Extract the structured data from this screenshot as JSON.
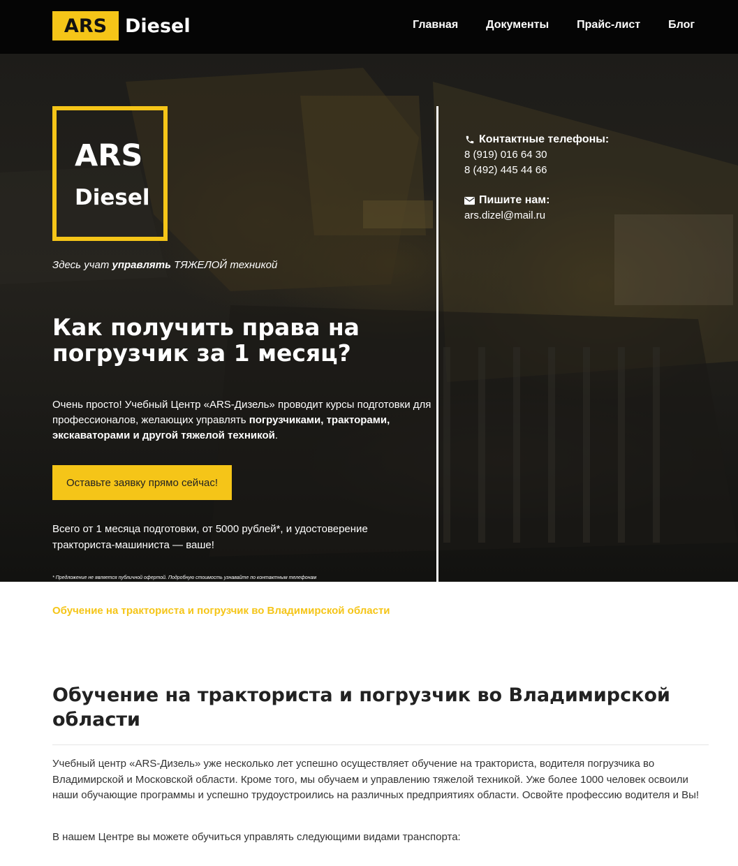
{
  "header": {
    "logo_box": "ARS",
    "logo_text": "Diesel",
    "nav": [
      "Главная",
      "Документы",
      "Прайс-лист",
      "Блог"
    ]
  },
  "hero": {
    "badge_line1": "ARS",
    "badge_line2": "Diesel",
    "tagline_pre": "Здесь учат ",
    "tagline_bold": "управлять",
    "tagline_post": " ТЯЖЕЛОЙ техникой",
    "title": "Как получить права на погрузчик за 1 месяц?",
    "desc_pre": "Очень просто! Учебный Центр «ARS-Дизель» проводит курсы подготовки для профессионалов, желающих управлять ",
    "desc_bold": "погрузчиками, тракторами, экскаваторами и другой тяжелой техникой",
    "desc_post": ".",
    "cta_label": "Оставьте заявку прямо сейчас!",
    "offer": "Всего от 1 месяца подготовки, от 5000 рублей*, и удостоверение тракториста-машиниста — ваше!",
    "note": "* Предложение не является публичной офертой. Подробную стоимость узнавайте по контактным телефонам"
  },
  "contacts": {
    "phones_heading": "Контактные телефоны:",
    "phone1": "8 (919) 016 64 30",
    "phone2": "8 (492) 445 44 66",
    "email_heading": "Пишите нам:",
    "email": "ars.dizel@mail.ru",
    "phone_icon": "phone-icon",
    "email_icon": "envelope-icon"
  },
  "content": {
    "breadcrumb": "Обучение на тракториста и погрузчик во Владимирской области",
    "title": "Обучение на тракториста и погрузчик во Владимирской области",
    "paragraph1": "Учебный центр «ARS-Дизель» уже несколько лет успешно осуществляет обучение на тракториста, водителя погрузчика во Владимирской и Московской области. Кроме того, мы обучаем и управлению тяжелой техникой. Уже более 1000 человек освоили наши обучающие программы и успешно трудоустроились на различных предприятиях области. Освойте профессию водителя и Вы!",
    "paragraph2": "В нашем Центре вы можете обучиться управлять следующими видами транспорта:"
  },
  "colors": {
    "accent": "#f5c518",
    "header_bg": "#050505"
  }
}
